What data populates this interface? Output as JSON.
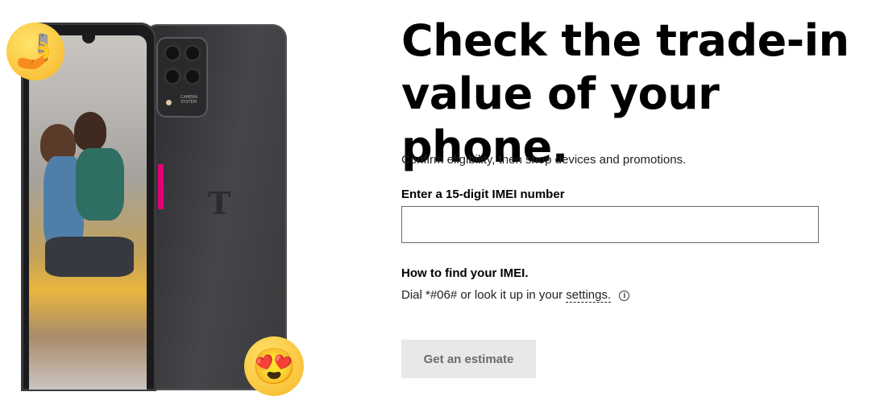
{
  "hero": {
    "emoji_top": "🤳",
    "emoji_bottom": "😍"
  },
  "main": {
    "headline": "Check the trade-in value of your phone.",
    "subtitle": "Confirm eligibility, then shop devices and promotions.",
    "imei_label": "Enter a 15-digit IMEI number",
    "imei_value": "",
    "imei_placeholder": "",
    "how_title": "How to find your IMEI.",
    "how_text": "Dial *#06# or look it up in your",
    "settings_link": "settings.",
    "info_icon_glyph": "i",
    "estimate_button": "Get an estimate"
  },
  "colors": {
    "brand_magenta": "#e20074",
    "button_disabled_bg": "#e8e8e8"
  }
}
